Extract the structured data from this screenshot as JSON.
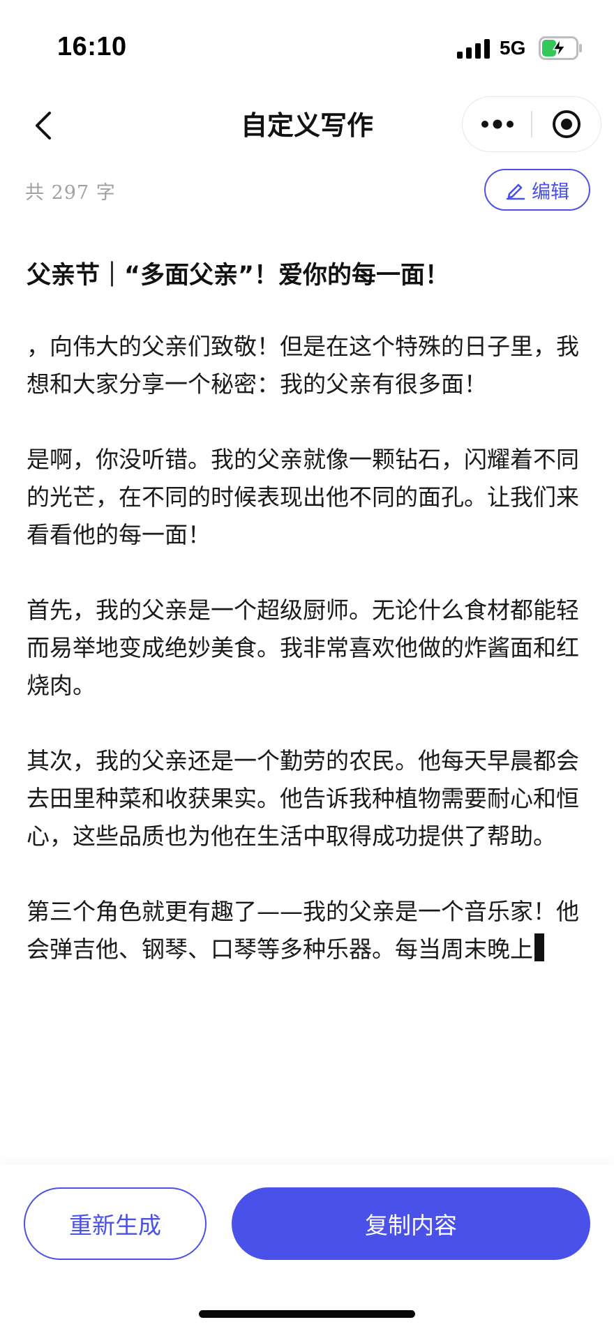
{
  "status_bar": {
    "time": "16:10",
    "network": "5G",
    "icons": [
      "signal-icon",
      "battery-charging-icon"
    ],
    "battery_color": "#34c759"
  },
  "nav": {
    "title": "自定义写作",
    "icons": [
      "back-chevron-icon",
      "more-dots-icon",
      "target-close-icon"
    ]
  },
  "meta": {
    "word_count_text": "共 297 字",
    "edit_label": "编辑",
    "edit_icon": "pencil-icon"
  },
  "article": {
    "title": "父亲节｜“多面父亲”！爱你的每一面！",
    "paragraphs": [
      "，向伟大的父亲们致敬！但是在这个特殊的日子里，我想和大家分享一个秘密：我的父亲有很多面！",
      "是啊，你没听错。我的父亲就像一颗钻石，闪耀着不同的光芒，在不同的时候表现出他不同的面孔。让我们来看看他的每一面！",
      "首先，我的父亲是一个超级厨师。无论什么食材都能轻而易举地变成绝妙美食。我非常喜欢他做的炸酱面和红烧肉。",
      "其次，我的父亲还是一个勤劳的农民。他每天早晨都会去田里种菜和收获果实。他告诉我种植物需要耐心和恒心，这些品质也为他在生活中取得成功提供了帮助。",
      "第三个角色就更有趣了——我的父亲是一个音乐家！他会弹吉他、钢琴、口琴等多种乐器。每当周末晚上"
    ]
  },
  "actions": {
    "regenerate_label": "重新生成",
    "copy_label": "复制内容"
  },
  "colors": {
    "accent": "#4a51e8",
    "muted_text": "#a0a0a0",
    "body_text": "#1a1a1a"
  }
}
